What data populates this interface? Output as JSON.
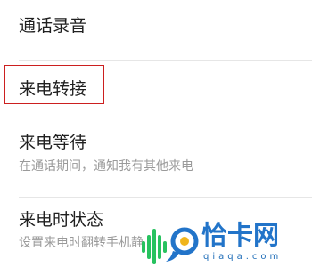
{
  "settings": {
    "items": [
      {
        "title": "通话录音"
      },
      {
        "title": "来电转接"
      },
      {
        "title": "来电等待",
        "subtitle": "在通话期间，通知我有其他来电"
      },
      {
        "title": "来电时状态",
        "subtitle": "设置来电时翻转手机静"
      }
    ]
  },
  "watermark": {
    "name": "恰卡网",
    "domain": "qiaqa.com"
  },
  "colors": {
    "highlight": "#cc1f1f",
    "brand_green": "#27c25f",
    "brand_blue": "#2274c9"
  }
}
